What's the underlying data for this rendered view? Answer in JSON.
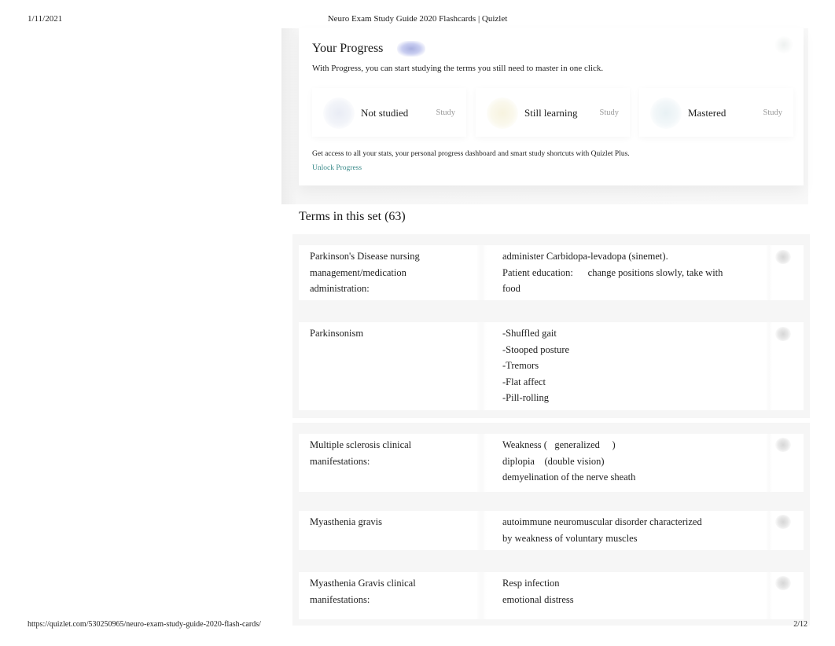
{
  "print_header": {
    "date": "1/11/2021",
    "title": "Neuro Exam Study Guide 2020 Flashcards | Quizlet"
  },
  "print_footer": {
    "url": "https://quizlet.com/530250965/neuro-exam-study-guide-2020-flash-cards/",
    "page": "2/12"
  },
  "progress": {
    "title": "Your Progress",
    "badge_icon": "plus-badge-icon",
    "description": "With Progress, you can start studying the terms you still need to master in one click.",
    "buckets": [
      {
        "label": "Not studied",
        "action": "Study",
        "icon": "not-studied-icon",
        "color": "#e9ecf5"
      },
      {
        "label": "Still learning",
        "action": "Study",
        "icon": "still-learning-icon",
        "color": "#f7f3df"
      },
      {
        "label": "Mastered",
        "action": "Study",
        "icon": "mastered-icon",
        "color": "#e8f1f4"
      }
    ],
    "plus_note": "Get access to all your stats, your personal progress dashboard and smart study shortcuts with Quizlet Plus.",
    "unlock_label": "Unlock Progress"
  },
  "terms_section": {
    "heading": "Terms in this set (63)",
    "terms": [
      {
        "term_lines": [
          "Parkinson's Disease nursing",
          "management/medication",
          "administration:"
        ],
        "definition_lines": [
          "administer Carbidopa-levadopa (sinemet).",
          "Patient education:      change positions slowly, take with",
          "food"
        ]
      },
      {
        "term_lines": [
          "Parkinsonism"
        ],
        "definition_lines": [
          "-Shuffled gait",
          "-Stooped posture",
          "-Tremors",
          "-Flat affect",
          "-Pill-rolling"
        ]
      },
      {
        "term_lines": [
          "Multiple sclerosis clinical",
          "manifestations:"
        ],
        "definition_lines": [
          "Weakness (   generalized     )",
          "diplopia    (double vision)",
          "demyelination of the nerve sheath"
        ]
      },
      {
        "term_lines": [
          "Myasthenia gravis"
        ],
        "definition_lines": [
          "autoimmune neuromuscular disorder characterized",
          "by weakness of voluntary muscles"
        ]
      },
      {
        "term_lines": [
          "Myasthenia Gravis clinical",
          "manifestations:"
        ],
        "definition_lines": [
          "Resp infection",
          "emotional distress"
        ]
      }
    ]
  }
}
